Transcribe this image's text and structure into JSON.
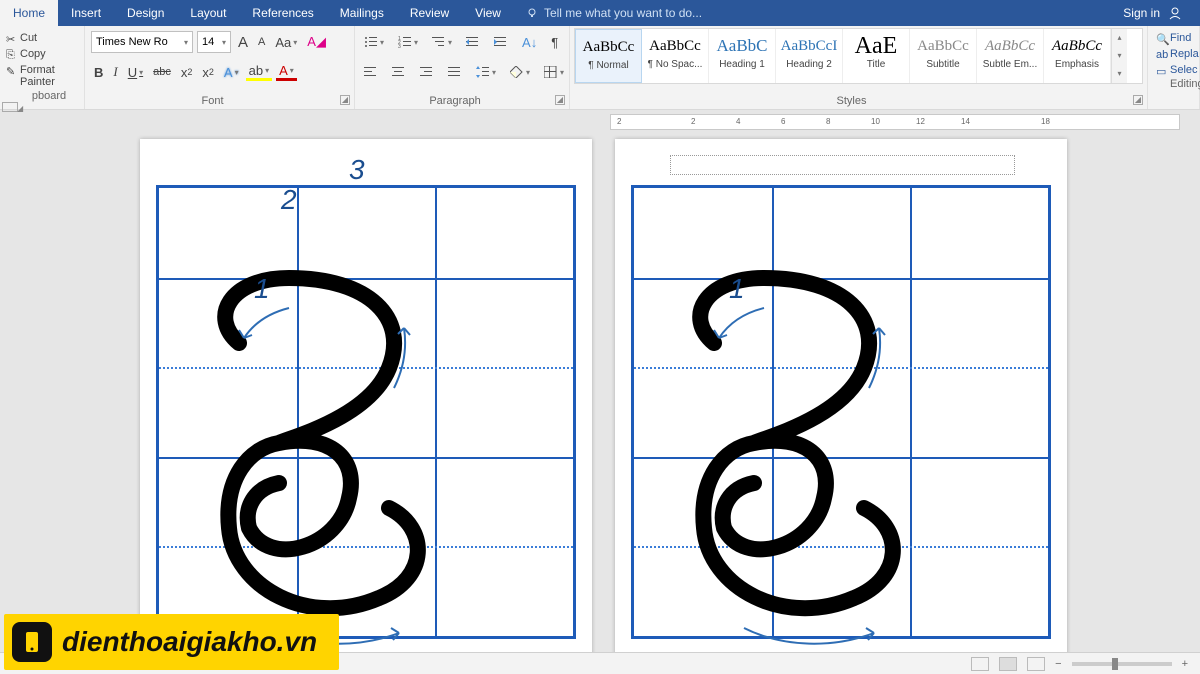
{
  "tabs": [
    "Home",
    "Insert",
    "Design",
    "Layout",
    "References",
    "Mailings",
    "Review",
    "View"
  ],
  "activeTab": "Home",
  "tellme": "Tell me what you want to do...",
  "signin": "Sign in",
  "clipboard": {
    "cut": "Cut",
    "copy": "Copy",
    "formatPainter": "Format Painter",
    "label": "pboard"
  },
  "font": {
    "name": "Times New Ro",
    "size": "14",
    "label": "Font",
    "grow": "A",
    "shrink": "A",
    "case": "Aa",
    "bold": "B",
    "italic": "I",
    "underline": "U",
    "strike": "abc",
    "sub": "x",
    "sup": "x",
    "fontcolor": "A",
    "highlight": "ab",
    "textfx": "A"
  },
  "paragraph": {
    "label": "Paragraph"
  },
  "styles": {
    "label": "Styles",
    "items": [
      {
        "preview": "AaBbCc",
        "label": "¶ Normal",
        "sel": true
      },
      {
        "preview": "AaBbCc",
        "label": "¶ No Spac..."
      },
      {
        "preview": "AaBbC",
        "label": "Heading 1",
        "color": "#2e74b5",
        "size": "17px"
      },
      {
        "preview": "AaBbCcI",
        "label": "Heading 2",
        "color": "#2e74b5",
        "size": "15px"
      },
      {
        "preview": "AaE",
        "label": "Title",
        "size": "24px"
      },
      {
        "preview": "AaBbCc",
        "label": "Subtitle",
        "color": "#888"
      },
      {
        "preview": "AaBbCc",
        "label": "Subtle Em...",
        "style": "italic",
        "color": "#888"
      },
      {
        "preview": "AaBbCc",
        "label": "Emphasis",
        "style": "italic"
      }
    ]
  },
  "editing": {
    "find": "Find",
    "replace": "Repla",
    "select": "Selec",
    "label": "Editing"
  },
  "ruler": [
    "2",
    "",
    "2",
    "4",
    "6",
    "8",
    "10",
    "12",
    "14",
    "",
    "18"
  ],
  "letters": {
    "left": {
      "n1": "1",
      "n2": "2",
      "n3": "3"
    },
    "right": {
      "n1": "1"
    }
  },
  "watermark": "dienthoaigiakho.vn"
}
